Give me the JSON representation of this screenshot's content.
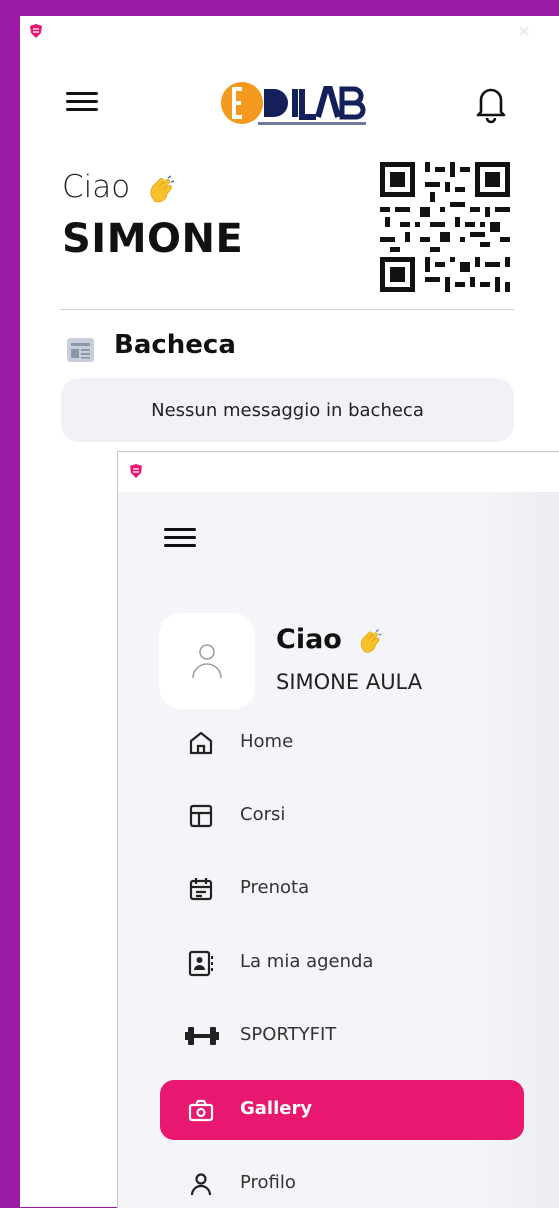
{
  "main": {
    "greeting": "Ciao",
    "user_first_name": "SIMONE",
    "bacheca_title": "Bacheca",
    "bacheca_empty_message": "Nessun messaggio in bacheca"
  },
  "drawer": {
    "greeting": "Ciao",
    "user_full_name": "SIMONE AULA",
    "items": [
      {
        "label": "Home",
        "icon": "home-icon",
        "active": false
      },
      {
        "label": "Corsi",
        "icon": "layout-icon",
        "active": false
      },
      {
        "label": "Prenota",
        "icon": "calendar-icon",
        "active": false
      },
      {
        "label": "La mia agenda",
        "icon": "contact-book-icon",
        "active": false
      },
      {
        "label": "SPORTYFIT",
        "icon": "dumbbell-icon",
        "active": false
      },
      {
        "label": "Gallery",
        "icon": "camera-icon",
        "active": true
      },
      {
        "label": "Profilo",
        "icon": "user-icon",
        "active": false
      }
    ]
  },
  "colors": {
    "desktop": "#9a1aa6",
    "accent": "#e8176f",
    "logo_orange": "#f39a1e",
    "logo_navy": "#13205a"
  }
}
